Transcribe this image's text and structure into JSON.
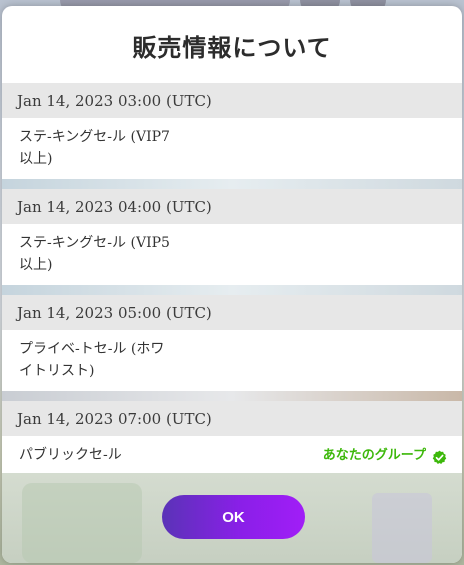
{
  "modal": {
    "title": "販売情報について",
    "ok_label": "OK"
  },
  "schedule": [
    {
      "datetime": "Jan 14, 2023 03:00 (UTC)",
      "sale_line1": "ステ-キングセ-ル (VIP7",
      "sale_line2": "以上)"
    },
    {
      "datetime": "Jan 14, 2023 04:00 (UTC)",
      "sale_line1": "ステ-キングセ-ル (VIP5",
      "sale_line2": "以上)"
    },
    {
      "datetime": "Jan 14, 2023 05:00 (UTC)",
      "sale_line1": "プライベ-トセ-ル (ホワ",
      "sale_line2": "イトリスト)"
    },
    {
      "datetime": "Jan 14, 2023 07:00 (UTC)",
      "sale_line1": "パブリックセ-ル",
      "group_label": "あなたのグループ"
    }
  ],
  "colors": {
    "accent_start": "#5a33b7",
    "accent_end": "#a11ef7",
    "group_green": "#3db80b"
  },
  "icons": {
    "group_check": "check-circle-icon"
  }
}
